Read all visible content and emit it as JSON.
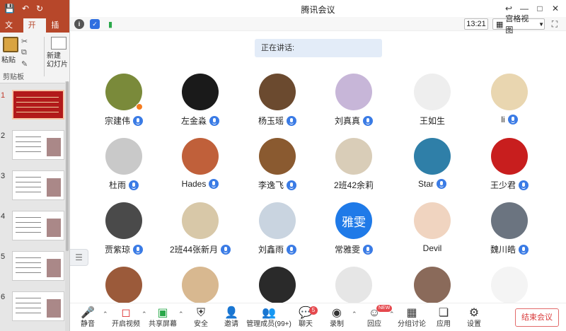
{
  "ppt": {
    "tabs": [
      "文件",
      "开始",
      "插入"
    ],
    "active_tab": "开始",
    "ribbon": {
      "paste": "粘贴",
      "group_clipboard": "剪贴板",
      "new_slide": "新建\n幻灯片"
    },
    "slides": [
      {
        "num": "1",
        "active": true
      },
      {
        "num": "2",
        "active": false
      },
      {
        "num": "3",
        "active": false
      },
      {
        "num": "4",
        "active": false
      },
      {
        "num": "5",
        "active": false
      },
      {
        "num": "6",
        "active": false
      }
    ]
  },
  "meeting": {
    "title": "腾讯会议",
    "time": "13:21",
    "view_label": "宫格视图",
    "speaking_label": "正在讲话:",
    "participants": [
      {
        "name": "宗建伟",
        "host": true,
        "color": "#7a8a3a"
      },
      {
        "name": "左金淼",
        "host": false,
        "color": "#1a1a1a"
      },
      {
        "name": "杨玉瑶",
        "host": false,
        "color": "#6b4a2f"
      },
      {
        "name": "刘真真",
        "host": false,
        "color": "#c7b6d8"
      },
      {
        "name": "王如生",
        "host": false,
        "color": "#eeeeee",
        "nomic": true
      },
      {
        "name": "li",
        "host": false,
        "color": "#e9d6b0"
      },
      {
        "name": "杜雨",
        "host": false,
        "color": "#c9c9c9"
      },
      {
        "name": "Hades",
        "host": false,
        "color": "#c0603a"
      },
      {
        "name": "李逸飞",
        "host": false,
        "color": "#8a5a30"
      },
      {
        "name": "2班42余莉",
        "host": false,
        "color": "#d9cdb8",
        "nomic": true
      },
      {
        "name": "Star",
        "host": false,
        "color": "#2f7fa8"
      },
      {
        "name": "王少君",
        "host": false,
        "color": "#c81e1e"
      },
      {
        "name": "贾紫琼",
        "host": false,
        "color": "#4a4a4a"
      },
      {
        "name": "2班44张新月",
        "host": false,
        "color": "#d8c8a8"
      },
      {
        "name": "刘鑫雨",
        "host": false,
        "color": "#c9d4e0"
      },
      {
        "name": "常雅雯",
        "host": false,
        "color": "#1f7ae8",
        "text": "雅雯"
      },
      {
        "name": "Devil",
        "host": false,
        "color": "#f0d4c0",
        "nomic": true
      },
      {
        "name": "魏川皓",
        "host": false,
        "color": "#6b7480"
      },
      {
        "name": "",
        "host": false,
        "color": "#9b5a3a",
        "row4": true
      },
      {
        "name": "",
        "host": false,
        "color": "#d8b890",
        "row4": true
      },
      {
        "name": "",
        "host": false,
        "color": "#2a2a2a",
        "row4": true
      },
      {
        "name": "",
        "host": false,
        "color": "#e6e6e6",
        "row4": true
      },
      {
        "name": "",
        "host": false,
        "color": "#8a6a5a",
        "row4": true
      },
      {
        "name": "",
        "host": false,
        "color": "#f4f4f4",
        "row4": true
      }
    ],
    "toolbar": {
      "mute": "静音",
      "video": "开启视频",
      "share": "共享屏幕",
      "security": "安全",
      "invite": "邀请",
      "manage": "管理成员(99+)",
      "chat": "聊天",
      "chat_badge": "5",
      "record": "录制",
      "reaction": "回应",
      "reaction_badge": "NEW",
      "breakout": "分组讨论",
      "apps": "应用",
      "settings": "设置",
      "end": "结束会议"
    }
  }
}
